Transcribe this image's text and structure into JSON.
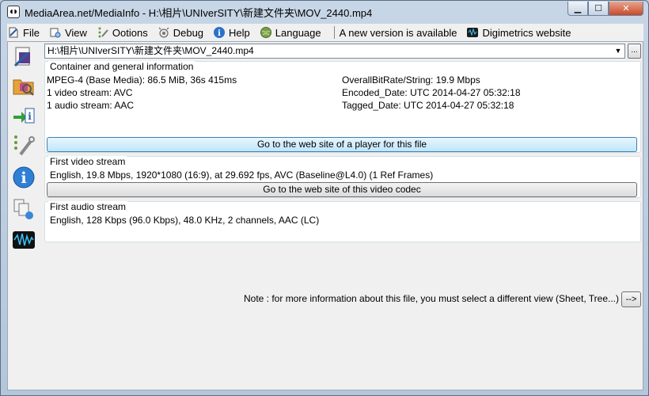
{
  "window": {
    "title": "MediaArea.net/MediaInfo - H:\\相片\\UNIverSITY\\新建文件夹\\MOV_2440.mp4",
    "controls": {
      "minimize": "▁",
      "maximize": "☐",
      "close": "✕"
    }
  },
  "menu": {
    "file": "File",
    "view": "View",
    "options": "Ootions",
    "debug": "Debug",
    "help": "Help",
    "language": "Language",
    "new_version": "A new version is available",
    "digimetrics": "Digimetrics website"
  },
  "sidebar": {
    "items": [
      {
        "name": "open-file-icon"
      },
      {
        "name": "open-folder-icon"
      },
      {
        "name": "export-info-icon"
      },
      {
        "name": "options-tools-icon"
      },
      {
        "name": "about-info-icon"
      },
      {
        "name": "copy-settings-icon"
      },
      {
        "name": "waveform-icon"
      }
    ]
  },
  "file_selector": {
    "value": "H:\\相片\\UNIverSITY\\新建文件夹\\MOV_2440.mp4",
    "arrow": "▼",
    "browse_label": "..."
  },
  "general": {
    "title": "Container and general information",
    "left": [
      "MPEG-4 (Base Media): 86.5 MiB, 36s 415ms",
      "1 video stream: AVC",
      "1 audio stream: AAC"
    ],
    "right": [
      "OverallBitRate/String: 19.9 Mbps",
      "Encoded_Date: UTC 2014-04-27 05:32:18",
      "Tagged_Date: UTC 2014-04-27 05:32:18"
    ],
    "player_button": "Go to the web site of a player for this file"
  },
  "video": {
    "title": "First video stream",
    "info": "English, 19.8 Mbps, 1920*1080 (16:9), at 29.692 fps, AVC (Baseline@L4.0) (1 Ref Frames)",
    "codec_button": "Go to the web site of this video codec"
  },
  "audio": {
    "title": "First audio stream",
    "info": "English, 128 Kbps (96.0 Kbps), 48.0 KHz, 2 channels, AAC (LC)"
  },
  "note": {
    "text": "Note : for more information about this file, you must select a different view (Sheet, Tree...)",
    "button": "-->"
  }
}
